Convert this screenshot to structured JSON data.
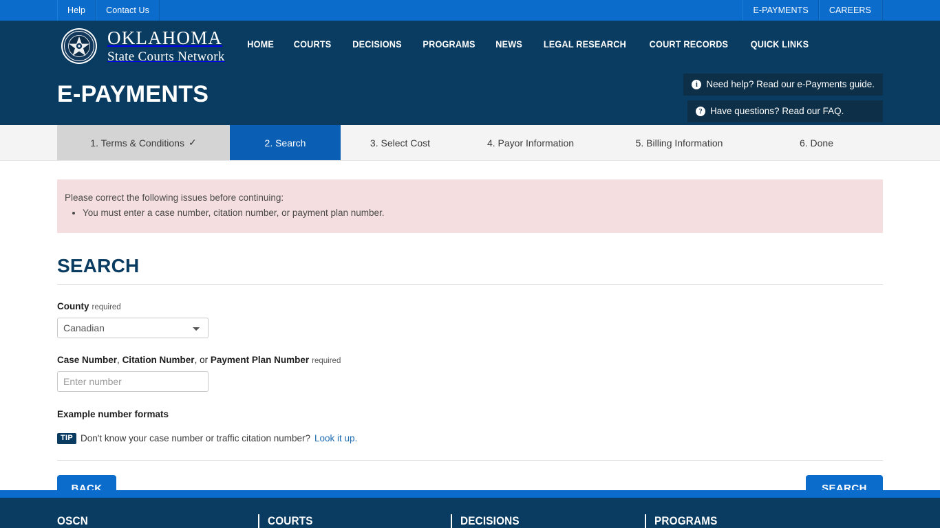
{
  "topbar": {
    "left_items": [
      {
        "label": "Help",
        "name": "help"
      },
      {
        "label": "Contact Us",
        "name": "contact-us"
      }
    ],
    "right_items": [
      {
        "label": "E-PAYMENTS",
        "name": "e-payments"
      },
      {
        "label": "CAREERS",
        "name": "careers"
      }
    ],
    "background_color": "#0b6ccc"
  },
  "header": {
    "brand_line1": "OKLAHOMA",
    "brand_line2": "State Courts Network",
    "seal_alt": "Oklahoma State Courts Seal",
    "background_color": "#0a3c61",
    "nav": [
      {
        "label": "HOME",
        "name": "home"
      },
      {
        "label": "COURTS",
        "name": "courts"
      },
      {
        "label": "DECISIONS",
        "name": "decisions"
      },
      {
        "label": "PROGRAMS",
        "name": "programs"
      },
      {
        "label": "NEWS",
        "name": "news"
      },
      {
        "label": "LEGAL RESEARCH",
        "name": "legal-research"
      },
      {
        "label": "COURT RECORDS",
        "name": "court-records"
      },
      {
        "label": "QUICK LINKS",
        "name": "quick-links"
      }
    ],
    "page_title": "E-PAYMENTS",
    "help_boxes": [
      {
        "icon": "info-icon",
        "glyph": "i",
        "label": "Need help? Read our e-Payments guide."
      },
      {
        "icon": "question-icon",
        "glyph": "?",
        "label": "Have questions? Read our FAQ."
      }
    ]
  },
  "stepper": {
    "steps": [
      {
        "label": "1. Terms & Conditions",
        "state": "done",
        "check": "✓"
      },
      {
        "label": "2. Search",
        "state": "active"
      },
      {
        "label": "3. Select Cost",
        "state": "todo"
      },
      {
        "label": "4. Payor Information",
        "state": "todo"
      },
      {
        "label": "5. Billing Information",
        "state": "todo"
      },
      {
        "label": "6. Done",
        "state": "todo"
      }
    ],
    "active_color": "#0a5fb4",
    "done_color": "#d4d4d4"
  },
  "alert": {
    "heading": "Please correct the following issues before continuing:",
    "items": [
      "You must enter a case number, citation number, or payment plan number."
    ],
    "background_color": "#f4dedf"
  },
  "form": {
    "section_title": "SEARCH",
    "county": {
      "label": "County",
      "required_text": "required",
      "selected": "Canadian",
      "options": [
        "Canadian"
      ]
    },
    "number": {
      "label_part1": "Case Number",
      "label_sep1": ", ",
      "label_part2": "Citation Number",
      "label_sep2": ", or ",
      "label_part3": "Payment Plan Number",
      "required_text": "required",
      "value": "",
      "placeholder": "Enter number"
    },
    "examples_title": "Example number formats",
    "tip": {
      "badge": "TIP",
      "text": "Don't know your case number or traffic citation number?",
      "link_text": "Look it up.",
      "link_color": "#1c6ab0"
    },
    "buttons": {
      "back": "BACK",
      "search": "SEARCH",
      "color": "#0b6ccc"
    }
  },
  "footer": {
    "accent_color": "#0b6ccc",
    "background_color": "#0a3c61",
    "columns": [
      {
        "title": "OSCN"
      },
      {
        "title": "COURTS"
      },
      {
        "title": "DECISIONS"
      },
      {
        "title": "PROGRAMS"
      }
    ]
  }
}
